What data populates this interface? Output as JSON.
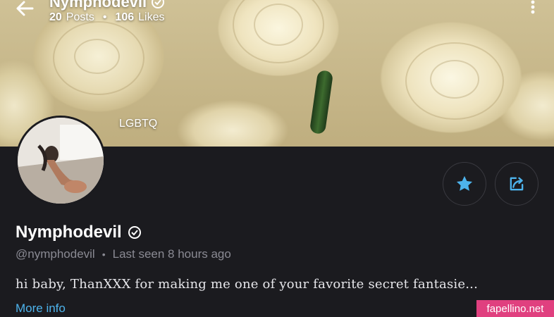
{
  "header": {
    "title": "Nymphodevil",
    "posts_count": "20",
    "posts_label": "Posts",
    "likes_count": "106",
    "likes_label": "Likes",
    "separator": "•"
  },
  "cover": {
    "tag": "LGBTQ"
  },
  "profile": {
    "name": "Nymphodevil",
    "handle": "@nymphodevil",
    "separator": "•",
    "last_seen": "Last seen 8 hours ago",
    "bio": "hi baby, ThanXXX for making me one of your favorite secret fantasie...",
    "more_info": "More info"
  },
  "watermark": "fapellino.net",
  "colors": {
    "accent": "#4db3ec",
    "background": "#1b1b1f",
    "muted": "#8a8a93",
    "watermark": "#e0407f"
  },
  "icons": [
    "back-arrow-icon",
    "verified-icon",
    "more-vertical-icon",
    "star-icon",
    "share-icon"
  ]
}
